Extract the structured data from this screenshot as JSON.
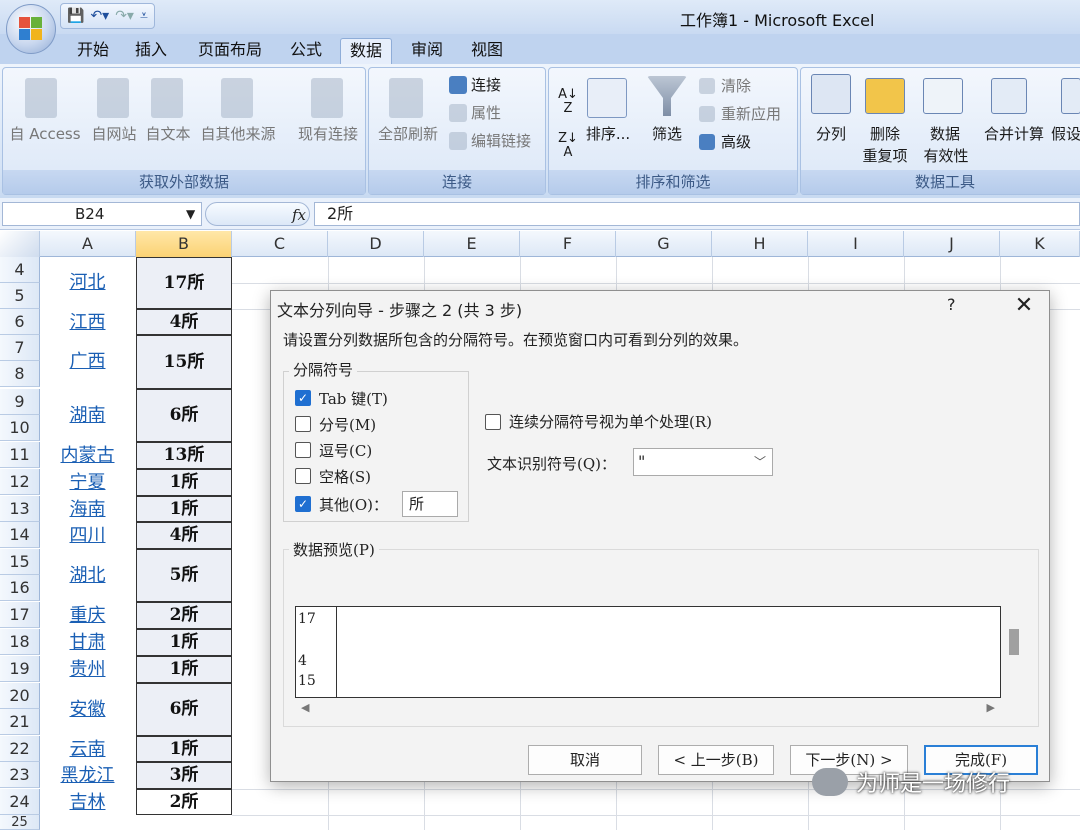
{
  "window": {
    "title": "工作簿1 - Microsoft Excel"
  },
  "tabs": [
    {
      "label": "开始"
    },
    {
      "label": "插入"
    },
    {
      "label": "页面布局"
    },
    {
      "label": "公式"
    },
    {
      "label": "数据"
    },
    {
      "label": "审阅"
    },
    {
      "label": "视图"
    }
  ],
  "ribbon": {
    "groups": {
      "external": "获取外部数据",
      "connections": "连接",
      "sort_filter": "排序和筛选",
      "data_tools": "数据工具"
    },
    "external": {
      "access": "自 Access",
      "web": "自网站",
      "text": "自文本",
      "other": "自其他来源",
      "existing": "现有连接"
    },
    "connections": {
      "refresh_all": "全部刷新",
      "connections": "连接",
      "properties": "属性",
      "edit_links": "编辑链接"
    },
    "sort_filter": {
      "sort": "排序...",
      "filter": "筛选",
      "clear": "清除",
      "reapply": "重新应用",
      "advanced": "高级"
    },
    "data_tools": {
      "text_to_columns": "分列",
      "remove_dup_1": "删除",
      "remove_dup_2": "重复项",
      "validation_1": "数据",
      "validation_2": "有效性",
      "consolidate": "合并计算",
      "whatif": "假设"
    }
  },
  "formula_bar": {
    "name_box": "B24",
    "fx": "fx",
    "value": "2所"
  },
  "columns": [
    "A",
    "B",
    "C",
    "D",
    "E",
    "F",
    "G",
    "H",
    "I",
    "J",
    "K"
  ],
  "rows": [
    "4",
    "5",
    "6",
    "7",
    "8",
    "9",
    "10",
    "11",
    "12",
    "13",
    "14",
    "15",
    "16",
    "17",
    "18",
    "19",
    "20",
    "21",
    "22",
    "23",
    "24",
    "25"
  ],
  "cells": [
    {
      "a": "河北",
      "b": "17所"
    },
    {
      "a": "江西",
      "b": "4所"
    },
    {
      "a": "广西",
      "b": "15所"
    },
    {
      "a": "湖南",
      "b": "6所"
    },
    {
      "a": "内蒙古",
      "b": "13所"
    },
    {
      "a": "宁夏",
      "b": "1所"
    },
    {
      "a": "海南",
      "b": "1所"
    },
    {
      "a": "四川",
      "b": "4所"
    },
    {
      "a": "湖北",
      "b": "5所"
    },
    {
      "a": "重庆",
      "b": "2所"
    },
    {
      "a": "甘肃",
      "b": "1所"
    },
    {
      "a": "贵州",
      "b": "1所"
    },
    {
      "a": "安徽",
      "b": "6所"
    },
    {
      "a": "云南",
      "b": "1所"
    },
    {
      "a": "黑龙江",
      "b": "3所"
    },
    {
      "a": "吉林",
      "b": "2所"
    }
  ],
  "dialog": {
    "title": "文本分列向导 - 步骤之 2 (共 3 步)",
    "help": "?",
    "close": "✕",
    "description": "请设置分列数据所包含的分隔符号。在预览窗口内可看到分列的效果。",
    "delimiters_label": "分隔符号",
    "tab": "Tab 键(T)",
    "semicolon": "分号(M)",
    "comma": "逗号(C)",
    "space": "空格(S)",
    "other": "其他(O)：",
    "other_value": "所",
    "consecutive": "连续分隔符号视为单个处理(R)",
    "qualifier_label": "文本识别符号(Q)：",
    "qualifier_value": "\"",
    "preview_label": "数据预览(P)",
    "preview_rows": [
      "17",
      "",
      "4",
      "15"
    ],
    "buttons": {
      "cancel": "取消",
      "back": "< 上一步(B)",
      "next": "下一步(N) >",
      "finish": "完成(F)"
    }
  },
  "watermark": "为师是一场修行"
}
